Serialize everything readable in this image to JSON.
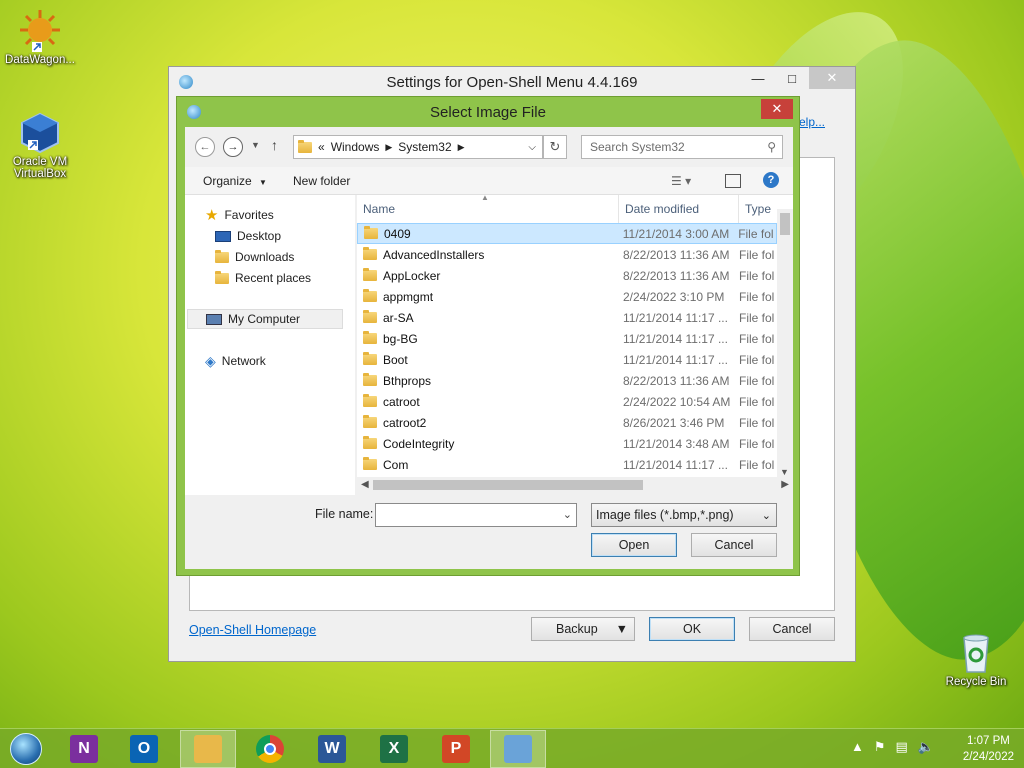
{
  "desktop": {
    "icons": [
      {
        "label": "DataWagon..."
      },
      {
        "label": "Oracle VM VirtualBox"
      },
      {
        "label": "Recycle Bin"
      }
    ]
  },
  "settings_window": {
    "title": "Settings for Open-Shell Menu 4.4.169",
    "help_link": "Help...",
    "homepage_link": "Open-Shell Homepage",
    "backup_label": "Backup",
    "ok_label": "OK",
    "cancel_label": "Cancel"
  },
  "file_dialog": {
    "title": "Select Image File",
    "breadcrumb": {
      "prefix": "«",
      "items": [
        "Windows",
        "System32"
      ]
    },
    "search_placeholder": "Search System32",
    "toolbar": {
      "organize": "Organize",
      "new_folder": "New folder"
    },
    "nav": {
      "favorites": "Favorites",
      "desktop": "Desktop",
      "downloads": "Downloads",
      "recent": "Recent places",
      "computer": "My Computer",
      "network": "Network"
    },
    "columns": {
      "name": "Name",
      "date": "Date modified",
      "type": "Type"
    },
    "files": [
      {
        "name": "0409",
        "date": "11/21/2014 3:00 AM",
        "type": "File fol"
      },
      {
        "name": "AdvancedInstallers",
        "date": "8/22/2013 11:36 AM",
        "type": "File fol"
      },
      {
        "name": "AppLocker",
        "date": "8/22/2013 11:36 AM",
        "type": "File fol"
      },
      {
        "name": "appmgmt",
        "date": "2/24/2022 3:10 PM",
        "type": "File fol"
      },
      {
        "name": "ar-SA",
        "date": "11/21/2014 11:17 ...",
        "type": "File fol"
      },
      {
        "name": "bg-BG",
        "date": "11/21/2014 11:17 ...",
        "type": "File fol"
      },
      {
        "name": "Boot",
        "date": "11/21/2014 11:17 ...",
        "type": "File fol"
      },
      {
        "name": "Bthprops",
        "date": "8/22/2013 11:36 AM",
        "type": "File fol"
      },
      {
        "name": "catroot",
        "date": "2/24/2022 10:54 AM",
        "type": "File fol"
      },
      {
        "name": "catroot2",
        "date": "8/26/2021 3:46 PM",
        "type": "File fol"
      },
      {
        "name": "CodeIntegrity",
        "date": "11/21/2014 3:48 AM",
        "type": "File fol"
      },
      {
        "name": "Com",
        "date": "11/21/2014 11:17 ...",
        "type": "File fol"
      }
    ],
    "file_name_label": "File name:",
    "file_name_value": "",
    "filter": "Image files (*.bmp,*.png)",
    "open_label": "Open",
    "cancel_label": "Cancel"
  },
  "taskbar": {
    "apps": [
      {
        "name": "OneNote",
        "letter": "N",
        "color": "#7b2f9e"
      },
      {
        "name": "Outlook",
        "letter": "O",
        "color": "#0a64b4"
      },
      {
        "name": "File Explorer",
        "letter": "",
        "color": "#e8b84a"
      },
      {
        "name": "Chrome",
        "letter": "",
        "color": "#db4437"
      },
      {
        "name": "Word",
        "letter": "W",
        "color": "#2b5797"
      },
      {
        "name": "Excel",
        "letter": "X",
        "color": "#1e7145"
      },
      {
        "name": "PowerPoint",
        "letter": "P",
        "color": "#d24726"
      },
      {
        "name": "Open-Shell Settings",
        "letter": "",
        "color": "#6aa3d8"
      }
    ],
    "time": "1:07 PM",
    "date": "2/24/2022"
  }
}
